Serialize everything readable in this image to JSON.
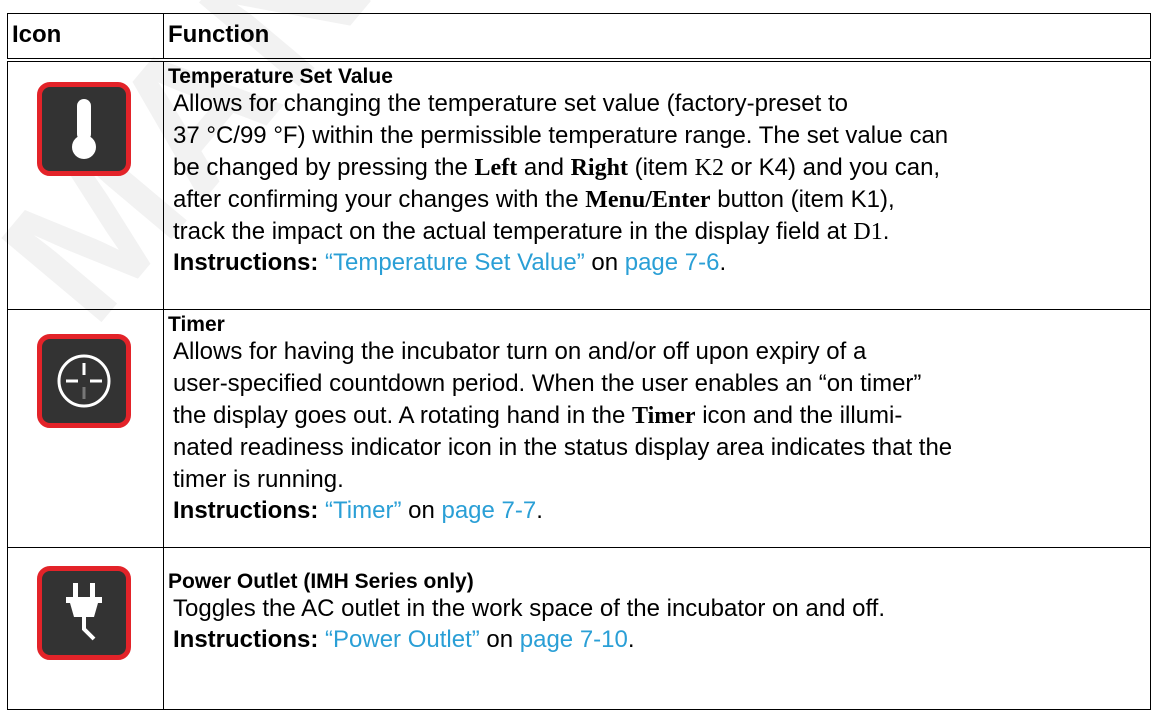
{
  "watermark": "MANUAL",
  "table": {
    "header": {
      "icon": "Icon",
      "function": "Function"
    },
    "rows": [
      {
        "icon": "thermometer-icon",
        "title": "Temperature Set Value",
        "desc": {
          "p1": "Allows for changing the temperature set value (factory-preset to",
          "p2": "37 °C/99 °F) within the permissible temperature range. The set value can",
          "p3": "be changed by pressing the ",
          "left": "Left",
          "and": " and ",
          "right": "Right",
          "p4": " (item ",
          "k2": "K2",
          "or": " or K4) and you can,",
          "p5": "after confirming your changes with the ",
          "menu": "Menu/Enter",
          "p6": " button (item K1),",
          "p7": "track the impact on the actual temperature in the display field at ",
          "d1": "D1",
          "end": "."
        },
        "instructions_label": "Instructions:",
        "instructions_link": "“Temperature Set Value”",
        "on": " on ",
        "page_link": "page 7-6",
        "period": "."
      },
      {
        "icon": "timer-icon",
        "title": "Timer",
        "desc": {
          "l1": "Allows for having the incubator turn on and/or off upon expiry of a",
          "l2": "user-specified countdown period. When the user enables an “on timer”",
          "l3a": "the display goes out. A rotating hand in the ",
          "timer": "Timer",
          "l3b": " icon and the illumi-",
          "l4": "nated readiness indicator icon in the status display area indicates that the",
          "l5": "timer is running."
        },
        "instructions_label": "Instructions:",
        "instructions_link": "“Timer”",
        "on": " on ",
        "page_link": "page 7-7",
        "period": "."
      },
      {
        "icon": "power-plug-icon",
        "title": "Power Outlet (IMH Series only)",
        "desc": {
          "l1": "Toggles the AC outlet in the work space of the incubator on and off."
        },
        "instructions_label": "Instructions:",
        "instructions_link": "“Power Outlet”",
        "on": " on ",
        "page_link": "page 7-10",
        "period": "."
      }
    ]
  },
  "colors": {
    "icon_border": "#e32329",
    "icon_bg": "#333333",
    "link": "#2a9fd6"
  }
}
